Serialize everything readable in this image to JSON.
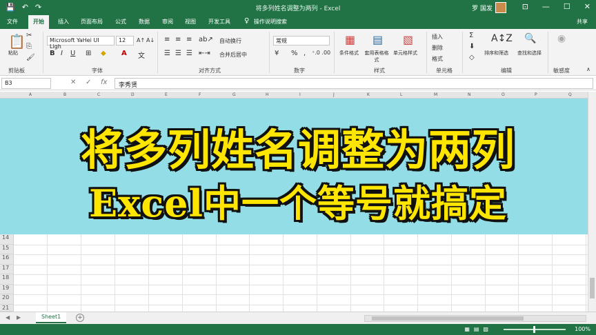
{
  "titlebar": {
    "title": "将多列姓名调整为两列 - Excel",
    "user": "罗 国发",
    "qat": {
      "save": "💾",
      "undo": "↶",
      "redo": "↷"
    },
    "window_buttons": {
      "ribbon_options": "⊡",
      "minimize": "—",
      "maximize": "☐",
      "close": "✕"
    }
  },
  "ribbon_tabs": [
    {
      "label": "文件"
    },
    {
      "label": "开始"
    },
    {
      "label": "插入"
    },
    {
      "label": "页面布局"
    },
    {
      "label": "公式"
    },
    {
      "label": "数据"
    },
    {
      "label": "审阅"
    },
    {
      "label": "视图"
    },
    {
      "label": "开发工具"
    },
    {
      "label": "操作说明搜索"
    }
  ],
  "share_label": "共享",
  "ribbon": {
    "clipboard": {
      "paste": "粘贴",
      "group": "剪贴板"
    },
    "font": {
      "name": "Microsoft YaHei UI Ligh",
      "size": "12",
      "bold": "B",
      "italic": "I",
      "underline": "U",
      "font_color": "A",
      "grow": "A↑",
      "shrink": "A↓",
      "group": "字体"
    },
    "alignment": {
      "wrap": "自动换行",
      "merge": "合并后居中",
      "group": "对齐方式"
    },
    "number": {
      "format": "常规",
      "percent": "%",
      "comma": ",",
      "group": "数字"
    },
    "styles": {
      "conditional": "条件格式",
      "table": "套用表格格式",
      "cell_styles": "单元格样式",
      "group": "样式"
    },
    "cells": {
      "insert": "插入",
      "delete": "删除",
      "format": "格式",
      "group": "单元格"
    },
    "editing": {
      "sort": "排序和筛选",
      "find": "查找和选择",
      "sum": "Σ",
      "group": "编辑"
    },
    "misc": {
      "label": "敏感度"
    }
  },
  "formula_bar": {
    "name_box": "B3",
    "cancel": "✕",
    "enter": "✓",
    "fx": "fx",
    "value": "李秀贤"
  },
  "column_headers": [
    "A",
    "B",
    "C",
    "D",
    "E",
    "F",
    "G",
    "H",
    "I",
    "J",
    "K",
    "L",
    "M",
    "N",
    "O",
    "P",
    "Q"
  ],
  "banner": {
    "line1": "将多列姓名调整为两列",
    "line2": "Excel中一个等号就搞定"
  },
  "row_numbers": [
    "14",
    "15",
    "16",
    "17",
    "18",
    "19",
    "20",
    "21"
  ],
  "sheet_tab": "Sheet1",
  "add_sheet": "+",
  "status": {
    "ready": "",
    "zoom": "100%"
  }
}
